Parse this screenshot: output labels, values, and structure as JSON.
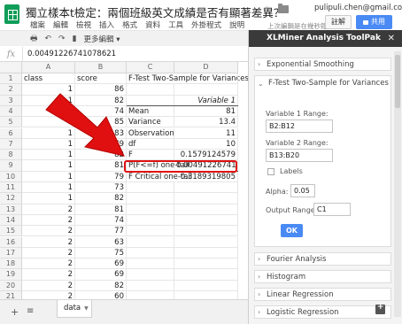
{
  "app": {
    "title": "獨立樣本t檢定：兩個班級英文成績是否有顯著差異？",
    "user_email": "pulipuli.chen@gmail.com",
    "save_status": "上次編輯是在幾秒鐘前",
    "comments_label": "註解",
    "share_label": "共用"
  },
  "menu": [
    "檔案",
    "編輯",
    "檢視",
    "插入",
    "格式",
    "資料",
    "工具",
    "外掛程式",
    "說明"
  ],
  "toolbar": {
    "more_label": "更多編輯"
  },
  "formula_bar": {
    "fx": "fx",
    "value": "0.00491226741078621"
  },
  "grid": {
    "columns": [
      "A",
      "B",
      "C",
      "D"
    ],
    "rows": [
      {
        "n": "1",
        "a": "class",
        "b": "score",
        "c": "F-Test Two-Sample for Variances",
        "d": ""
      },
      {
        "n": "2",
        "a": "1",
        "b": "86",
        "c": "",
        "d": ""
      },
      {
        "n": "3",
        "a": "1",
        "b": "82",
        "c": "",
        "d": "Variable 1"
      },
      {
        "n": "4",
        "a": "1",
        "b": "74",
        "c": "Mean",
        "d": "81"
      },
      {
        "n": "5",
        "a": "1",
        "b": "85",
        "c": "Variance",
        "d": "13.4"
      },
      {
        "n": "6",
        "a": "1",
        "b": "83",
        "c": "Observations",
        "d": "11"
      },
      {
        "n": "7",
        "a": "1",
        "b": "79",
        "c": "df",
        "d": "10"
      },
      {
        "n": "8",
        "a": "1",
        "b": "82",
        "c": "F",
        "d": "0.1579124579"
      },
      {
        "n": "9",
        "a": "1",
        "b": "81",
        "c": "P(F<=f) one-tail",
        "d": "0.004912267411"
      },
      {
        "n": "10",
        "a": "1",
        "b": "79",
        "c": "F Critical one-tail",
        "d": "0.3189319805"
      },
      {
        "n": "11",
        "a": "1",
        "b": "73",
        "c": "",
        "d": ""
      },
      {
        "n": "12",
        "a": "1",
        "b": "82",
        "c": "",
        "d": ""
      },
      {
        "n": "13",
        "a": "2",
        "b": "81",
        "c": "",
        "d": ""
      },
      {
        "n": "14",
        "a": "2",
        "b": "74",
        "c": "",
        "d": ""
      },
      {
        "n": "15",
        "a": "2",
        "b": "77",
        "c": "",
        "d": ""
      },
      {
        "n": "16",
        "a": "2",
        "b": "63",
        "c": "",
        "d": ""
      },
      {
        "n": "17",
        "a": "2",
        "b": "75",
        "c": "",
        "d": ""
      },
      {
        "n": "18",
        "a": "2",
        "b": "69",
        "c": "",
        "d": ""
      },
      {
        "n": "19",
        "a": "2",
        "b": "69",
        "c": "",
        "d": ""
      },
      {
        "n": "20",
        "a": "2",
        "b": "82",
        "c": "",
        "d": ""
      },
      {
        "n": "21",
        "a": "2",
        "b": "60",
        "c": "",
        "d": ""
      }
    ]
  },
  "sheet_tab": "data",
  "sidebar": {
    "title": "XLMiner Analysis ToolPak",
    "sections": {
      "exp": "Exponential Smoothing",
      "ftest": "F-Test Two-Sample for Variances",
      "fourier": "Fourier Analysis",
      "histogram": "Histogram",
      "linreg": "Linear Regression",
      "logreg": "Logistic Regression"
    },
    "form": {
      "var1_label": "Variable 1 Range:",
      "var1_value": "B2:B12",
      "var2_label": "Variable 2 Range:",
      "var2_value": "B13:B20",
      "labels_label": "Labels",
      "alpha_label": "Alpha:",
      "alpha_value": "0.05",
      "output_label": "Output Range:",
      "output_value": "C1",
      "ok_label": "OK"
    }
  },
  "colors": {
    "accent": "#4a8af4",
    "brand": "#0f9d58",
    "annotation": "#e01010"
  }
}
